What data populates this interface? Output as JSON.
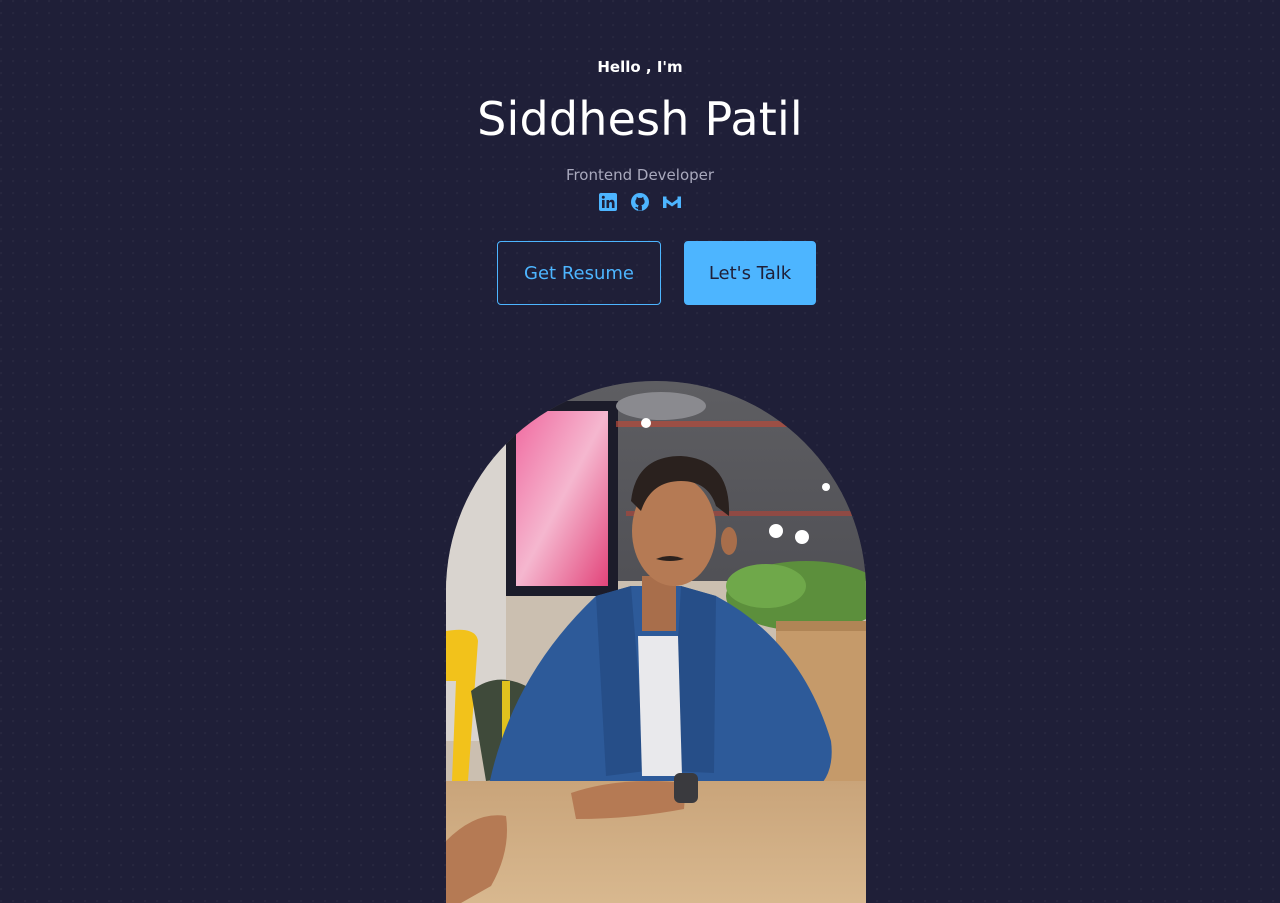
{
  "hero": {
    "greeting": "Hello , I'm",
    "name": "Siddhesh Patil",
    "role": "Frontend Developer"
  },
  "socials": [
    {
      "icon": "linkedin-icon"
    },
    {
      "icon": "github-icon"
    },
    {
      "icon": "gmail-icon"
    }
  ],
  "buttons": {
    "resume_label": "Get Resume",
    "talk_label": "Let's Talk"
  },
  "colors": {
    "background": "#1f1f38",
    "accent": "#4db5ff",
    "text": "#ffffff",
    "muted": "#a9a9bd"
  }
}
